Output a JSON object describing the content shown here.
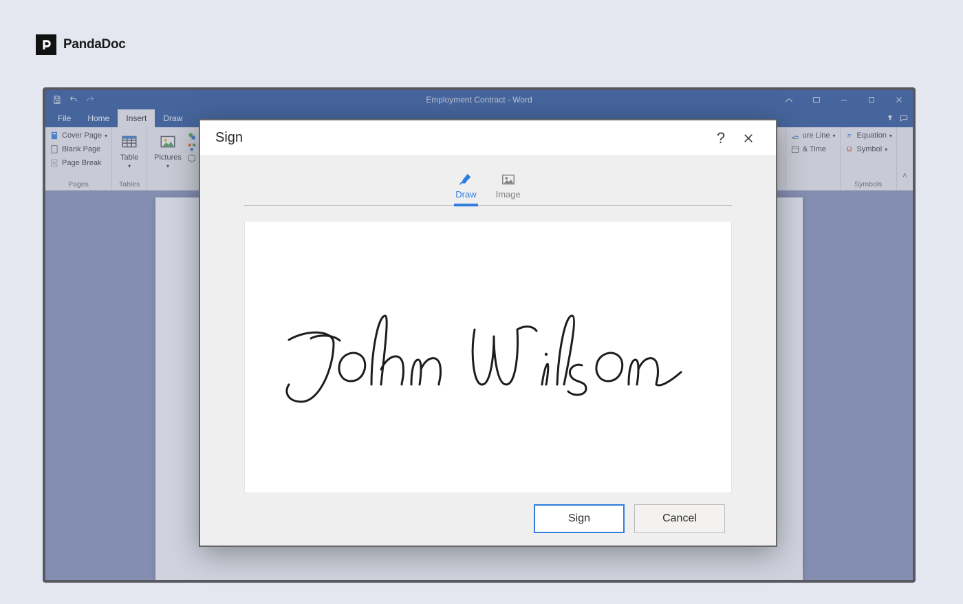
{
  "brand": {
    "name": "PandaDoc"
  },
  "word": {
    "titlebar": {
      "title": "Employment Contract - Word"
    },
    "menu": {
      "file": "File",
      "home": "Home",
      "insert": "Insert",
      "draw": "Draw"
    },
    "ribbon": {
      "pages_group": "Pages",
      "cover_page": "Cover Page",
      "blank_page": "Blank Page",
      "page_break": "Page Break",
      "tables_group": "Tables",
      "table": "Table",
      "pictures": "Pictures",
      "signature_line": "ure Line",
      "date_time": "& Time",
      "symbols_group": "Symbols",
      "equation": "Equation",
      "symbol": "Symbol"
    }
  },
  "dialog": {
    "title": "Sign",
    "help": "?",
    "tabs": {
      "draw": "Draw",
      "image": "Image"
    },
    "signature_text": "John Wilson",
    "buttons": {
      "sign": "Sign",
      "cancel": "Cancel"
    }
  }
}
